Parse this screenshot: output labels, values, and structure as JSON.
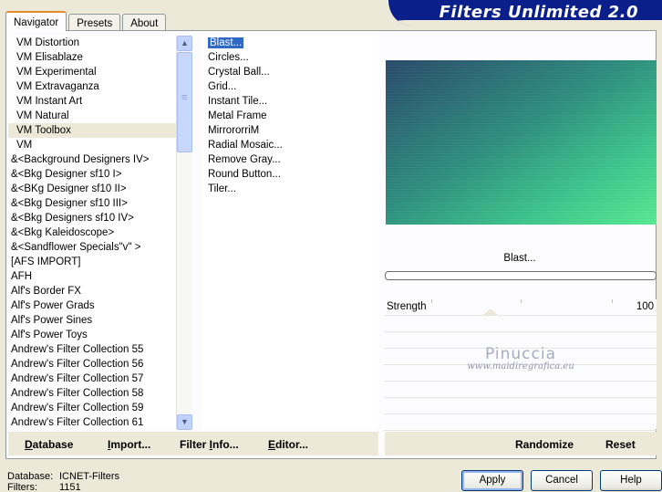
{
  "app": {
    "title": "Filters Unlimited 2.0"
  },
  "tabs": [
    {
      "label": "Navigator",
      "active": true
    },
    {
      "label": "Presets",
      "active": false
    },
    {
      "label": "About",
      "active": false
    }
  ],
  "categories": {
    "selected_index": 6,
    "items": [
      "VM Distortion",
      "VM Elisablaze",
      "VM Experimental",
      "VM Extravaganza",
      "VM Instant Art",
      "VM Natural",
      "VM Toolbox",
      "VM",
      "&<Background Designers IV>",
      "&<Bkg Designer sf10 I>",
      "&<BKg Designer sf10 II>",
      "&<Bkg Designer sf10 III>",
      "&<Bkg Designers sf10 IV>",
      "&<Bkg Kaleidoscope>",
      "&<Sandflower Specials\"v\" >",
      "[AFS IMPORT]",
      "AFH",
      "Alf's Border FX",
      "Alf's Power Grads",
      "Alf's Power Sines",
      "Alf's Power Toys",
      "Andrew's Filter Collection 55",
      "Andrew's Filter Collection 56",
      "Andrew's Filter Collection 57",
      "Andrew's Filter Collection 58",
      "Andrew's Filter Collection 59",
      "Andrew's Filter Collection 61"
    ]
  },
  "filters": {
    "selected_index": 0,
    "items": [
      "Blast...",
      "Circles...",
      "Crystal Ball...",
      "Grid...",
      "Instant Tile...",
      "Metal Frame",
      "MirrororriM",
      "Radial Mosaic...",
      "Remove Gray...",
      "Round Button...",
      "Tiler..."
    ]
  },
  "preview": {
    "filter_name": "Blast...",
    "progress_fraction": 0,
    "parameters": [
      {
        "label": "Strength",
        "value": "100"
      }
    ],
    "empty_rows": 7
  },
  "watermark": {
    "name": "Pinuccia",
    "url": "www.maidiregrafica.eu"
  },
  "left_buttons": [
    {
      "key": "D",
      "rest": "atabase"
    },
    {
      "key": "I",
      "rest": "mport..."
    },
    {
      "key": "",
      "rest": "Filter ",
      "key2": "I",
      "rest2": "nfo..."
    },
    {
      "key": "E",
      "rest": "ditor..."
    }
  ],
  "right_buttons": {
    "randomize": "Randomize",
    "reset": "Reset"
  },
  "status": {
    "database_label": "Database:",
    "database_value": "ICNET-Filters",
    "filters_label": "Filters:",
    "filters_value": "1151"
  },
  "dialog_buttons": {
    "apply": "Apply",
    "cancel": "Cancel",
    "help": "Help"
  },
  "colors": {
    "banner": "#0a1f8a",
    "selection": "#316ac5",
    "tab_highlight": "#e68b2c"
  }
}
